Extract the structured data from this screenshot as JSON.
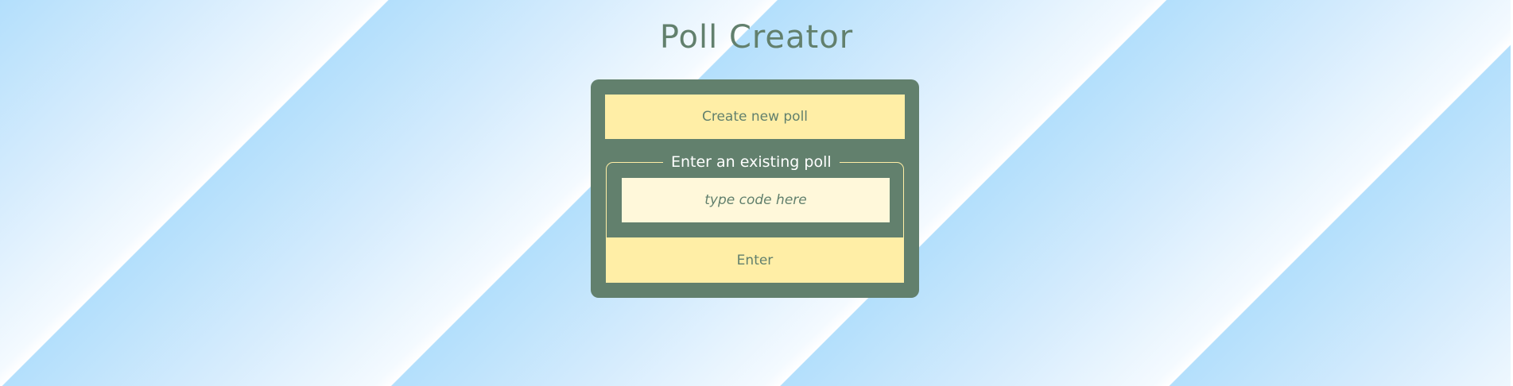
{
  "header": {
    "title": "Poll Creator"
  },
  "card": {
    "create_label": "Create new poll",
    "existing_legend": "Enter an existing poll",
    "code_input": {
      "placeholder": "type code here",
      "value": ""
    },
    "enter_label": "Enter"
  },
  "colors": {
    "card_background": "#62806d",
    "button_background": "#ffeea6",
    "input_background": "#fff8da",
    "text": "#62806d",
    "background_light": "#ffffff",
    "background_blue": "#b3dffc"
  }
}
